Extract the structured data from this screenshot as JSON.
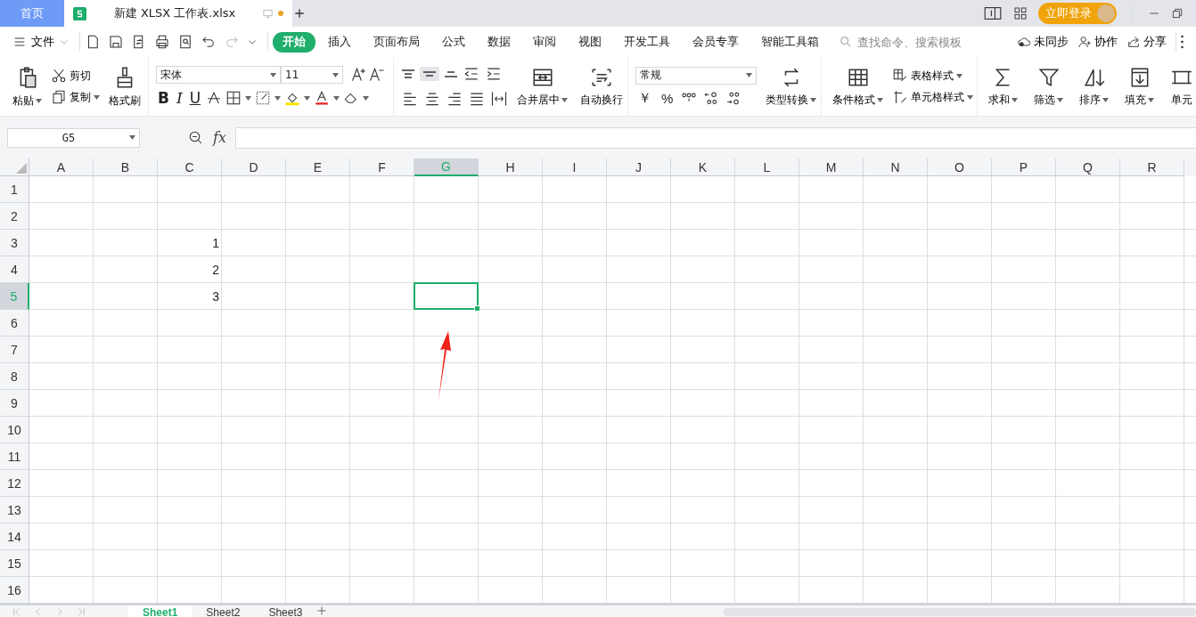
{
  "title_bar": {
    "tabs": [
      {
        "label": "首页",
        "kind": "home",
        "selected": false,
        "unsaved": false
      },
      {
        "label": "新建 XLSX 工作表.xlsx",
        "kind": "document",
        "selected": true,
        "unsaved": true
      }
    ],
    "login_button": "立即登录"
  },
  "menu_bar": {
    "file_menu": "文件",
    "tabs": [
      {
        "label": "开始",
        "selected": true
      },
      {
        "label": "插入",
        "selected": false
      },
      {
        "label": "页面布局",
        "selected": false
      },
      {
        "label": "公式",
        "selected": false
      },
      {
        "label": "数据",
        "selected": false
      },
      {
        "label": "审阅",
        "selected": false
      },
      {
        "label": "视图",
        "selected": false
      },
      {
        "label": "开发工具",
        "selected": false
      },
      {
        "label": "会员专享",
        "selected": false
      },
      {
        "label": "智能工具箱",
        "selected": false
      }
    ],
    "search": {
      "placeholder": "查找命令、搜索模板"
    },
    "actions": [
      {
        "label": "未同步",
        "kind": "cloud"
      },
      {
        "label": "协作",
        "kind": "person"
      },
      {
        "label": "分享",
        "kind": "share"
      }
    ]
  },
  "ribbon": {
    "paste": "粘贴",
    "cut": "剪切",
    "copy": "复制",
    "format_painter": "格式刷",
    "font_name": "宋体",
    "font_size": "11",
    "font_styles": [
      "B",
      "I",
      "U"
    ],
    "merge_center": "合并居中",
    "wrap_text": "自动换行",
    "number_format": "常规",
    "number_symbols": [
      "￥",
      "%"
    ],
    "convert_type": "类型转换",
    "conditional_format": "条件格式",
    "table_style": "表格样式",
    "cell_style": "单元格样式",
    "tools": [
      {
        "label": "求和",
        "kind": "sum"
      },
      {
        "label": "筛选",
        "kind": "filter"
      },
      {
        "label": "排序",
        "kind": "sort"
      },
      {
        "label": "填充",
        "kind": "fill"
      },
      {
        "label": "单元",
        "kind": "cell"
      }
    ]
  },
  "formula_bar": {
    "name_box": "G5",
    "fx": "fx"
  },
  "sheet": {
    "columns": [
      {
        "label": "A",
        "selected": false
      },
      {
        "label": "B",
        "selected": false
      },
      {
        "label": "C",
        "selected": false
      },
      {
        "label": "D",
        "selected": false
      },
      {
        "label": "E",
        "selected": false
      },
      {
        "label": "F",
        "selected": false
      },
      {
        "label": "G",
        "selected": true
      },
      {
        "label": "H",
        "selected": false
      },
      {
        "label": "I",
        "selected": false
      },
      {
        "label": "J",
        "selected": false
      },
      {
        "label": "K",
        "selected": false
      },
      {
        "label": "L",
        "selected": false
      },
      {
        "label": "M",
        "selected": false
      },
      {
        "label": "N",
        "selected": false
      },
      {
        "label": "O",
        "selected": false
      },
      {
        "label": "P",
        "selected": false
      },
      {
        "label": "Q",
        "selected": false
      },
      {
        "label": "R",
        "selected": false
      }
    ],
    "rows": [
      {
        "label": "1",
        "selected": false
      },
      {
        "label": "2",
        "selected": false
      },
      {
        "label": "3",
        "selected": false,
        "cells": [
          null,
          null,
          "1"
        ]
      },
      {
        "label": "4",
        "selected": false,
        "cells": [
          null,
          null,
          "2"
        ]
      },
      {
        "label": "5",
        "selected": true,
        "cells": [
          null,
          null,
          "3"
        ]
      },
      {
        "label": "6",
        "selected": false
      },
      {
        "label": "7",
        "selected": false
      },
      {
        "label": "8",
        "selected": false
      },
      {
        "label": "9",
        "selected": false
      },
      {
        "label": "10",
        "selected": false
      },
      {
        "label": "11",
        "selected": false
      },
      {
        "label": "12",
        "selected": false
      },
      {
        "label": "13",
        "selected": false
      },
      {
        "label": "14",
        "selected": false
      },
      {
        "label": "15",
        "selected": false
      },
      {
        "label": "16",
        "selected": false
      }
    ]
  },
  "sheet_tabs": [
    {
      "label": "Sheet1",
      "selected": true
    },
    {
      "label": "Sheet2",
      "selected": false
    },
    {
      "label": "Sheet3",
      "selected": false
    }
  ]
}
